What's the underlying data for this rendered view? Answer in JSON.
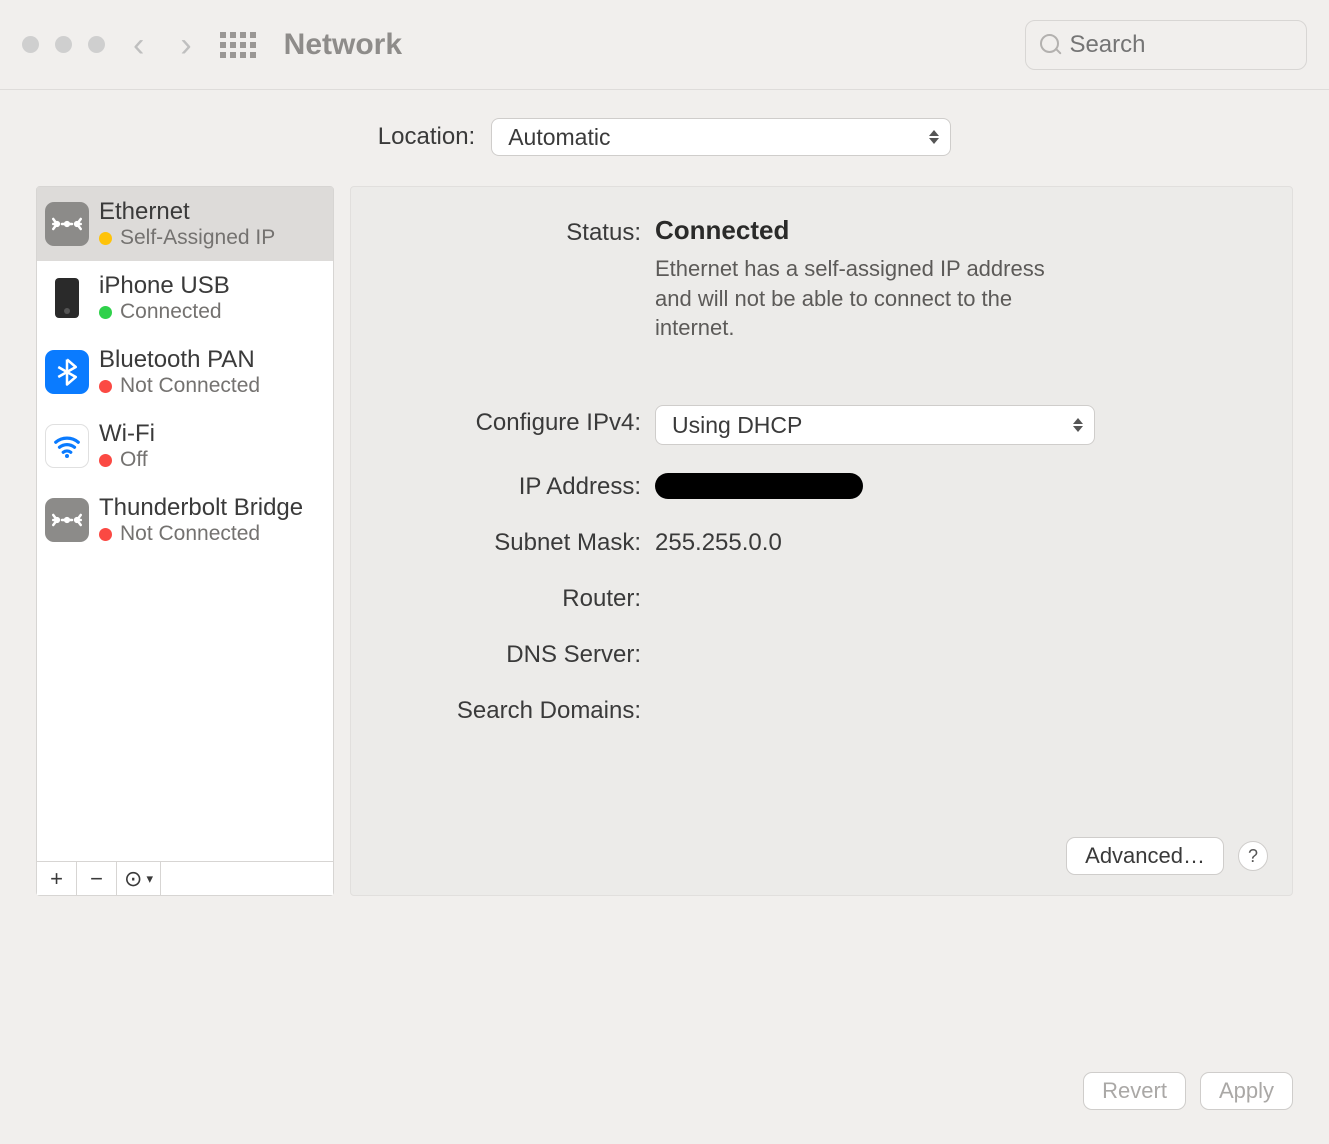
{
  "toolbar": {
    "title": "Network",
    "search_placeholder": "Search"
  },
  "location": {
    "label": "Location:",
    "value": "Automatic"
  },
  "sidebar": {
    "items": [
      {
        "name": "Ethernet",
        "status": "Self-Assigned IP",
        "dot": "yellow",
        "icon": "ethernet",
        "selected": true
      },
      {
        "name": "iPhone USB",
        "status": "Connected",
        "dot": "green",
        "icon": "iphone",
        "selected": false
      },
      {
        "name": "Bluetooth PAN",
        "status": "Not Connected",
        "dot": "red",
        "icon": "bluetooth",
        "selected": false
      },
      {
        "name": "Wi-Fi",
        "status": "Off",
        "dot": "red",
        "icon": "wifi",
        "selected": false
      },
      {
        "name": "Thunderbolt Bridge",
        "status": "Not Connected",
        "dot": "red",
        "icon": "ethernet",
        "selected": false
      }
    ],
    "buttons": {
      "add": "+",
      "remove": "−",
      "more": "⊙"
    }
  },
  "details": {
    "status_label": "Status:",
    "status_value": "Connected",
    "status_sub": "Ethernet has a self-assigned IP address and will not be able to connect to the internet.",
    "configure_label": "Configure IPv4:",
    "configure_value": "Using DHCP",
    "ip_label": "IP Address:",
    "subnet_label": "Subnet Mask:",
    "subnet_value": "255.255.0.0",
    "router_label": "Router:",
    "router_value": "",
    "dns_label": "DNS Server:",
    "dns_value": "",
    "search_label": "Search Domains:",
    "search_value": "",
    "advanced": "Advanced…",
    "help": "?"
  },
  "footer": {
    "revert": "Revert",
    "apply": "Apply"
  }
}
